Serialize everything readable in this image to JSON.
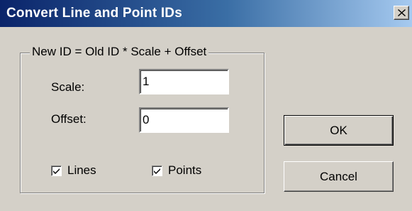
{
  "window": {
    "title": "Convert Line and Point IDs",
    "close_icon": "close-x-icon"
  },
  "group": {
    "legend": "New ID = Old ID * Scale + Offset",
    "scale": {
      "label": "Scale:",
      "value": "1"
    },
    "offset": {
      "label": "Offset:",
      "value": "0"
    },
    "checkboxes": {
      "lines": {
        "label": "Lines",
        "checked": true
      },
      "points": {
        "label": "Points",
        "checked": true
      }
    }
  },
  "buttons": {
    "ok_label": "OK",
    "cancel_label": "Cancel"
  },
  "colors": {
    "titlebar_start": "#0a246a",
    "titlebar_end": "#a6caf0",
    "face": "#d4d0c8"
  }
}
